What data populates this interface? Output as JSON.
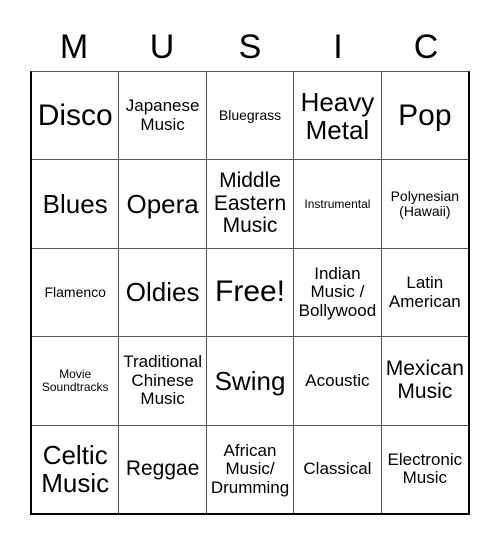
{
  "card": {
    "title_letters": [
      "M",
      "U",
      "S",
      "I",
      "C"
    ],
    "grid": {
      "rows": 5,
      "columns": 5,
      "cells": [
        [
          {
            "label": "Disco",
            "size": "xl"
          },
          {
            "label": "Japanese\nMusic",
            "size": "sm"
          },
          {
            "label": "Bluegrass",
            "size": "xs"
          },
          {
            "label": "Heavy\nMetal",
            "size": "lg"
          },
          {
            "label": "Pop",
            "size": "xl"
          }
        ],
        [
          {
            "label": "Blues",
            "size": "lg"
          },
          {
            "label": "Opera",
            "size": "lg"
          },
          {
            "label": "Middle\nEastern\nMusic",
            "size": "md"
          },
          {
            "label": "Instrumental",
            "size": "xxs"
          },
          {
            "label": "Polynesian\n(Hawaii)",
            "size": "xs"
          }
        ],
        [
          {
            "label": "Flamenco",
            "size": "xs"
          },
          {
            "label": "Oldies",
            "size": "lg"
          },
          {
            "label": "Free!",
            "size": "xl"
          },
          {
            "label": "Indian\nMusic /\nBollywood",
            "size": "sm"
          },
          {
            "label": "Latin\nAmerican",
            "size": "sm"
          }
        ],
        [
          {
            "label": "Movie\nSoundtracks",
            "size": "xxs"
          },
          {
            "label": "Traditional\nChinese\nMusic",
            "size": "sm"
          },
          {
            "label": "Swing",
            "size": "lg"
          },
          {
            "label": "Acoustic",
            "size": "sm"
          },
          {
            "label": "Mexican\nMusic",
            "size": "md"
          }
        ],
        [
          {
            "label": "Celtic\nMusic",
            "size": "lg"
          },
          {
            "label": "Reggae",
            "size": "md"
          },
          {
            "label": "African\nMusic/\nDrumming",
            "size": "sm"
          },
          {
            "label": "Classical",
            "size": "sm"
          },
          {
            "label": "Electronic\nMusic",
            "size": "sm"
          }
        ]
      ]
    },
    "colors": {
      "background": "#ffffff",
      "text": "#000000",
      "grid_line": "#555555",
      "grid_border": "#000000"
    }
  }
}
